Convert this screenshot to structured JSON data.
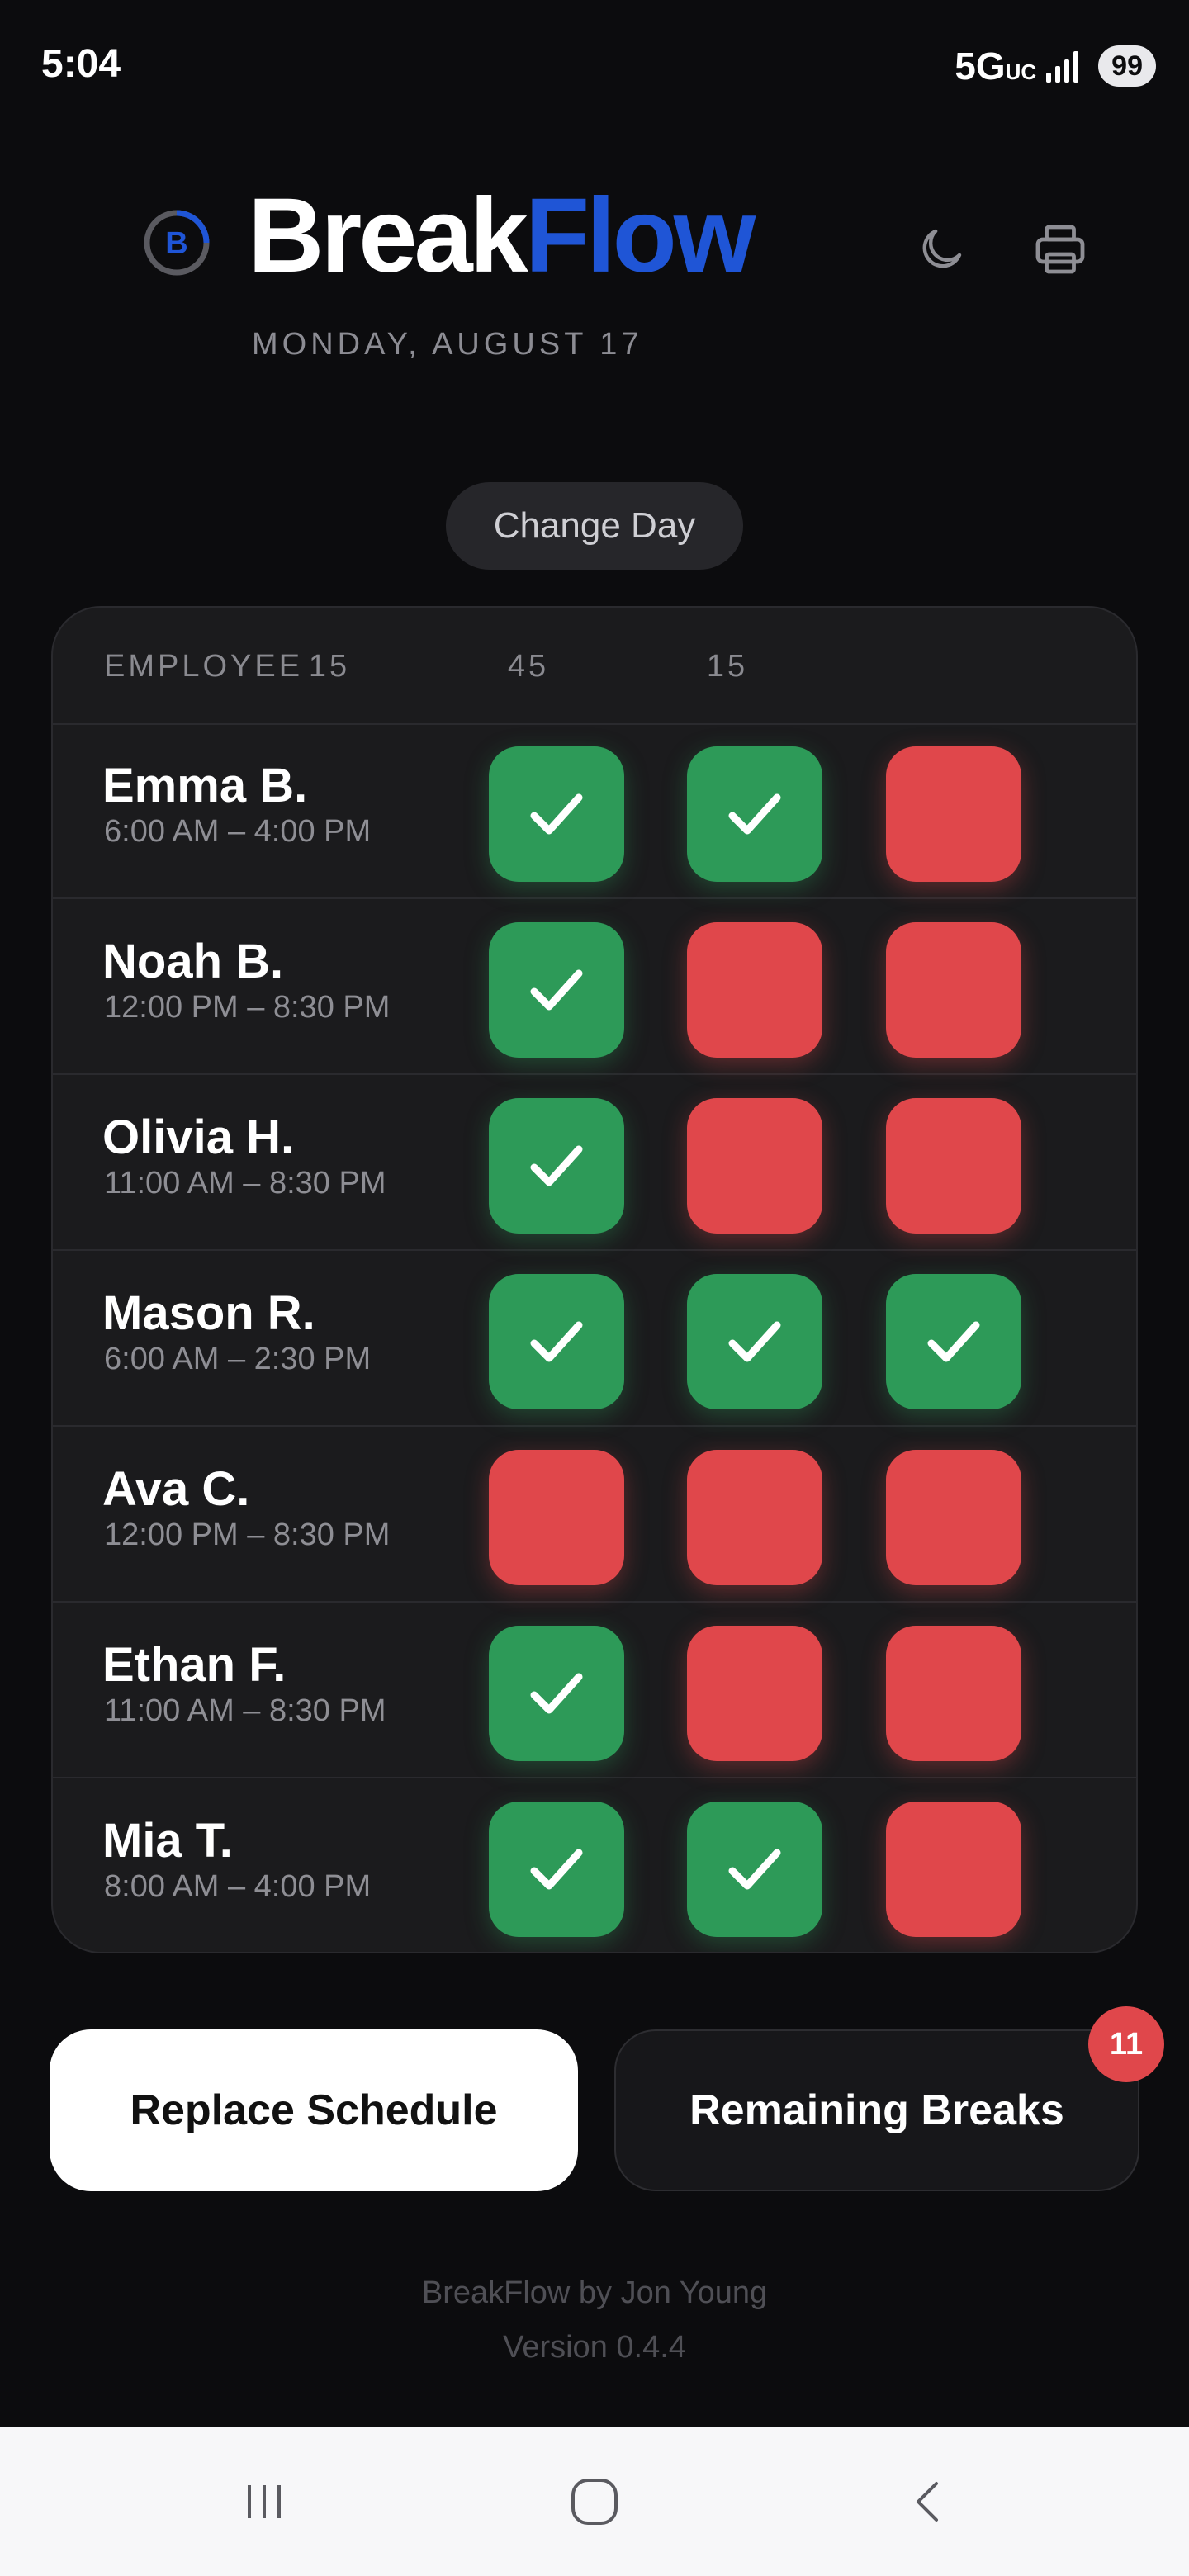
{
  "status_bar": {
    "time": "5:04",
    "network": "5G",
    "network_sub": "UC",
    "battery": "99"
  },
  "header": {
    "title_part1": "Break",
    "title_part2": "Flow",
    "logo_letter": "B",
    "date": "MONDAY, AUGUST 17",
    "title_accent_color": "#1f55d6",
    "icons": [
      "moon-icon",
      "printer-icon"
    ]
  },
  "change_day_label": "Change Day",
  "table": {
    "headers": [
      "EMPLOYEE",
      "15",
      "45",
      "15"
    ],
    "rows": [
      {
        "name": "Emma B.",
        "shift": "6:00 AM – 4:00 PM",
        "breaks": [
          true,
          true,
          false
        ]
      },
      {
        "name": "Noah B.",
        "shift": "12:00 PM – 8:30 PM",
        "breaks": [
          true,
          false,
          false
        ]
      },
      {
        "name": "Olivia H.",
        "shift": "11:00 AM – 8:30 PM",
        "breaks": [
          true,
          false,
          false
        ]
      },
      {
        "name": "Mason R.",
        "shift": "6:00 AM – 2:30 PM",
        "breaks": [
          true,
          true,
          true
        ]
      },
      {
        "name": "Ava C.",
        "shift": "12:00 PM – 8:30 PM",
        "breaks": [
          false,
          false,
          false
        ]
      },
      {
        "name": "Ethan F.",
        "shift": "11:00 AM – 8:30 PM",
        "breaks": [
          true,
          false,
          false
        ]
      },
      {
        "name": "Mia T.",
        "shift": "8:00 AM – 4:00 PM",
        "breaks": [
          true,
          true,
          false
        ]
      }
    ],
    "colors": {
      "done": "#2d9a58",
      "todo": "#e0474b"
    }
  },
  "actions": {
    "replace_label": "Replace Schedule",
    "remaining_label": "Remaining Breaks",
    "remaining_count": "11"
  },
  "footer": {
    "credit": "BreakFlow by Jon Young",
    "version": "Version 0.4.4"
  },
  "nav": [
    "recent-apps-icon",
    "home-icon",
    "back-icon"
  ]
}
